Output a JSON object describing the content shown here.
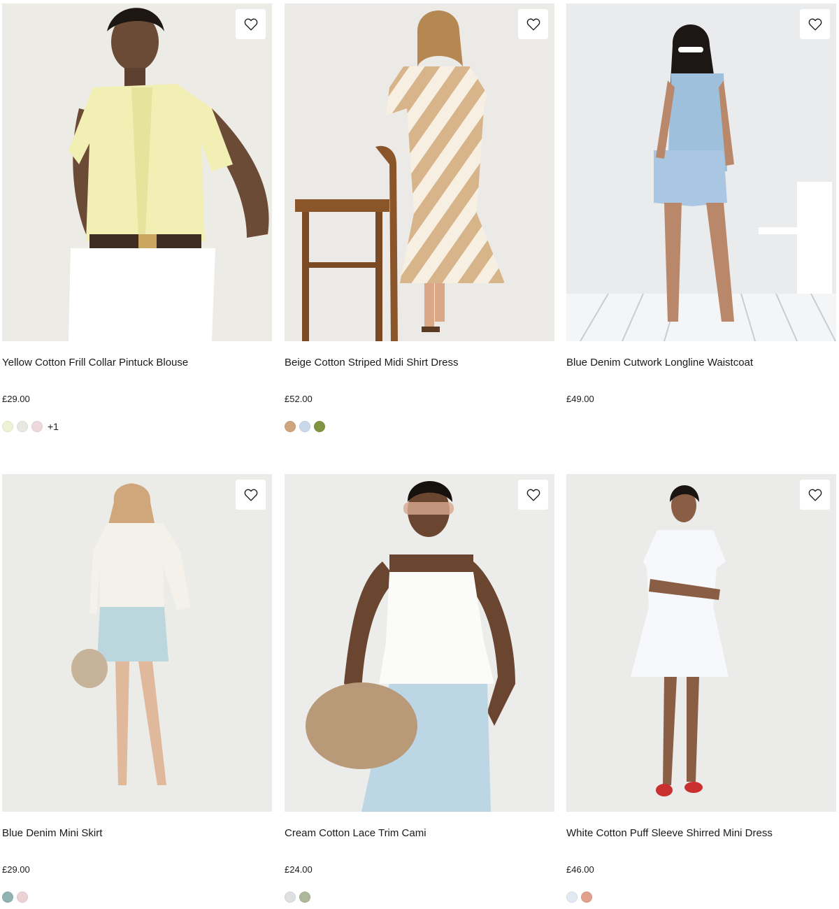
{
  "products": [
    {
      "name": "Yellow Cotton Frill Collar Pintuck Blouse",
      "price": "£29.00",
      "swatches": [
        "#eef2d4",
        "#e8e8e2",
        "#ecd8dd"
      ],
      "more_colours": "+1",
      "image": {
        "bg": "#ecebe6",
        "garment": "#f1efb4",
        "accent": "#ffffff"
      }
    },
    {
      "name": "Beige Cotton Striped Midi Shirt Dress",
      "price": "£52.00",
      "swatches": [
        "#cfa47e",
        "#c9d8ea",
        "#7f953f"
      ],
      "more_colours": "",
      "image": {
        "bg": "#ebeae6",
        "garment": "#d8b48a",
        "accent": "#f6efe2"
      }
    },
    {
      "name": "Blue Denim Cutwork Longline Waistcoat",
      "price": "£49.00",
      "swatches": [],
      "more_colours": "",
      "image": {
        "bg": "#eaebed",
        "garment": "#9ec0dc",
        "accent": "#f4f5f6"
      }
    },
    {
      "name": "Blue Denim Mini Skirt",
      "price": "£29.00",
      "swatches": [
        "#8fb3b1",
        "#ecd2d4"
      ],
      "more_colours": "",
      "image": {
        "bg": "#ebebe8",
        "garment": "#bcd6de",
        "accent": "#f3f1ea"
      }
    },
    {
      "name": "Cream Cotton Lace Trim Cami",
      "price": "£24.00",
      "swatches": [
        "#dfe0e2",
        "#adb89a"
      ],
      "more_colours": "",
      "image": {
        "bg": "#ececeb",
        "garment": "#fbfbf9",
        "accent": "#bcd6e6"
      }
    },
    {
      "name": "White Cotton Puff Sleeve Shirred Mini Dress",
      "price": "£46.00",
      "swatches": [
        "#e2e9f2",
        "#e0a08c"
      ],
      "more_colours": "",
      "image": {
        "bg": "#ebebea",
        "garment": "#f7f8fb",
        "accent": "#c9302f"
      }
    }
  ],
  "icons": {
    "wishlist": "heart-outline-icon"
  }
}
